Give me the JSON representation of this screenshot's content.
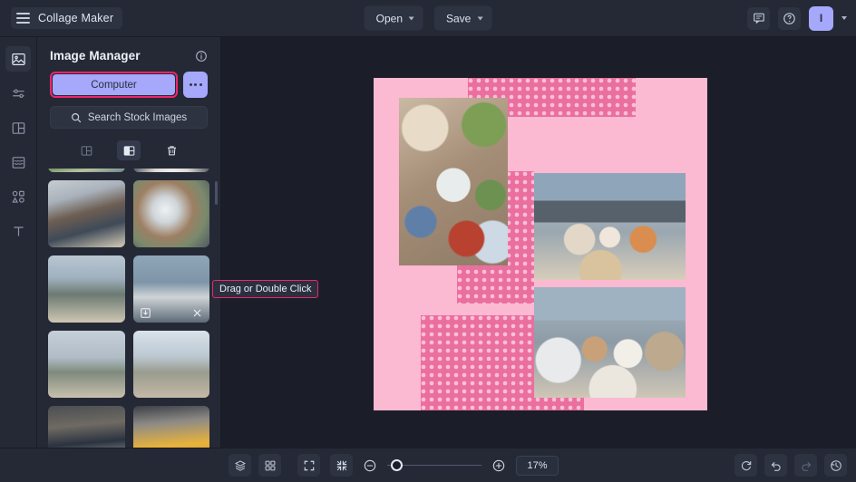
{
  "app": {
    "title": "Collage Maker",
    "menu_icon": "hamburger-icon"
  },
  "topbar": {
    "open_label": "Open",
    "save_label": "Save",
    "feedback_icon": "chat-icon",
    "help_icon": "question-circle-icon",
    "avatar_initial": "I",
    "avatar_color": "#a5a8fb"
  },
  "rail": {
    "items": [
      {
        "name": "image-manager",
        "icon": "image-icon",
        "active": true
      },
      {
        "name": "adjustments",
        "icon": "sliders-icon",
        "active": false
      },
      {
        "name": "layouts",
        "icon": "layout-icon",
        "active": false
      },
      {
        "name": "background",
        "icon": "background-icon",
        "active": false
      },
      {
        "name": "shapes",
        "icon": "shapes-icon",
        "active": false
      },
      {
        "name": "text",
        "icon": "text-icon",
        "active": false
      }
    ]
  },
  "panel": {
    "title": "Image Manager",
    "info_icon": "info-icon",
    "computer_label": "Computer",
    "more_label": "...",
    "stock_label": "Search Stock Images",
    "search_icon": "search-icon",
    "highlight_color": "#f0256c",
    "views": [
      {
        "name": "view-single",
        "icon": "panel-single-icon",
        "active": false
      },
      {
        "name": "view-split",
        "icon": "panel-split-icon",
        "active": true
      },
      {
        "name": "delete-all",
        "icon": "trash-icon",
        "active": false
      }
    ],
    "thumb_overlay": {
      "download_icon": "download-icon",
      "close_icon": "close-icon"
    }
  },
  "tooltip": {
    "text": "Drag or Double Click"
  },
  "canvas": {
    "background_color": "#fcb9d2",
    "pattern_color": "#ea6f9f",
    "pattern_dot_color": "#fbc0d6"
  },
  "bottombar": {
    "layers_icon": "layers-icon",
    "grid_icon": "grid-icon",
    "fit_icon": "fit-screen-icon",
    "shrink_icon": "shrink-icon",
    "zoom_out_icon": "minus-circle-icon",
    "zoom_in_icon": "plus-circle-icon",
    "zoom_value": "17%",
    "reset_icon": "reset-icon",
    "undo_icon": "undo-icon",
    "redo_icon": "redo-icon",
    "history_icon": "history-icon"
  }
}
